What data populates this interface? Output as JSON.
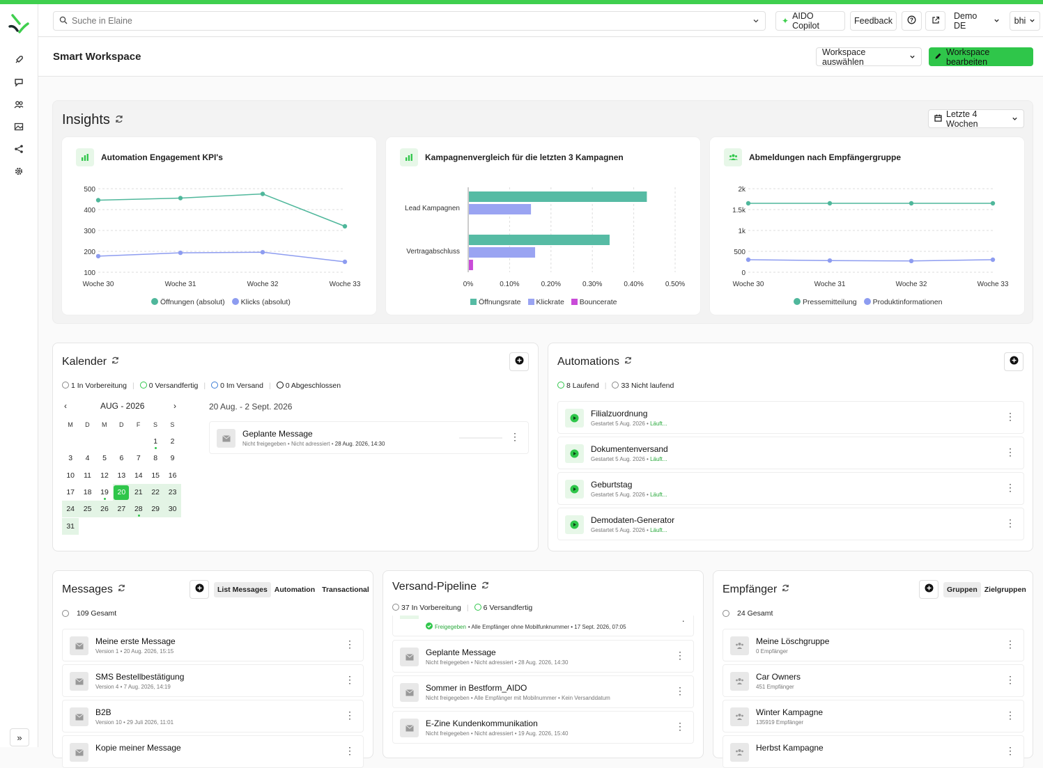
{
  "header": {
    "search_placeholder": "Suche in Elaine",
    "copilot": "AIDO Copilot",
    "feedback": "Feedback",
    "account": "Demo DE",
    "user": "bhi"
  },
  "page": {
    "title": "Smart Workspace",
    "select_workspace": "Workspace auswählen",
    "edit_workspace": "Workspace bearbeiten"
  },
  "insights": {
    "title": "Insights",
    "range": "Letzte 4 Wochen",
    "kpi": {
      "title": "Automation Engagement KPI's",
      "legend": [
        "Öffnungen (absolut)",
        "Klicks (absolut)"
      ]
    },
    "campaign": {
      "title": "Kampagnenvergleich für die letzten 3 Kampagnen",
      "legend": [
        "Öffnungsrate",
        "Klickrate",
        "Bouncerate"
      ]
    },
    "unsub": {
      "title": "Abmeldungen nach Empfängergruppe",
      "legend": [
        "Pressemitteilung",
        "Produktinformationen"
      ]
    }
  },
  "chart_data": [
    {
      "type": "line",
      "categories": [
        "Woche 30",
        "Woche 31",
        "Woche 32",
        "Woche 33"
      ],
      "ylim": [
        100,
        500
      ],
      "yticks": [
        "500",
        "400",
        "300",
        "200",
        "100"
      ],
      "series": [
        {
          "name": "Öffnungen (absolut)",
          "values": [
            445,
            455,
            475,
            320
          ],
          "color": "#4fb79b"
        },
        {
          "name": "Klicks (absolut)",
          "values": [
            177,
            193,
            196,
            150
          ],
          "color": "#8d9cf0"
        }
      ]
    },
    {
      "type": "bar",
      "orientation": "horizontal",
      "categories": [
        "Lead Kampagnen",
        "Vertragabschluss"
      ],
      "xlim": [
        0,
        0.5
      ],
      "xticks": [
        "0%",
        "0.10%",
        "0.20%",
        "0.30%",
        "0.40%",
        "0.50%"
      ],
      "series": [
        {
          "name": "Öffnungsrate",
          "values": [
            0.43,
            0.34
          ],
          "color": "#56bba4"
        },
        {
          "name": "Klickrate",
          "values": [
            0.15,
            0.16
          ],
          "color": "#9aa4f2"
        },
        {
          "name": "Bouncerate",
          "values": [
            0,
            0.01
          ],
          "color": "#c94bd8"
        }
      ]
    },
    {
      "type": "line",
      "categories": [
        "Woche 30",
        "Woche 31",
        "Woche 32",
        "Woche 33"
      ],
      "ylim": [
        0,
        2000
      ],
      "yticks": [
        "2k",
        "1.5k",
        "1k",
        "500",
        "0"
      ],
      "series": [
        {
          "name": "Pressemitteilung",
          "values": [
            1650,
            1650,
            1650,
            1650
          ],
          "color": "#4fb79b"
        },
        {
          "name": "Produktinformationen",
          "values": [
            300,
            280,
            270,
            300
          ],
          "color": "#8d9cf0"
        }
      ]
    }
  ],
  "kalender": {
    "title": "Kalender",
    "status": [
      "1 In Vorbereitung",
      "0 Versandfertig",
      "0 Im Versand",
      "0 Abgeschlossen"
    ],
    "month": "AUG - 2026",
    "weekdays": [
      "M",
      "D",
      "M",
      "D",
      "F",
      "S",
      "S"
    ],
    "range": "20 Aug. - 2 Sept. 2026",
    "msg_title": "Geplante Message",
    "msg_sub_a": "Nicht freigegeben • Nicht adressiert • ",
    "msg_sub_b": "28 Aug. 2026, 14:30"
  },
  "automations": {
    "title": "Automations",
    "status": [
      "8 Laufend",
      "33 Nicht laufend"
    ],
    "items": [
      {
        "t": "Filialzuordnung",
        "s": "Gestartet 5 Aug. 2026 • ",
        "st": "Läuft..."
      },
      {
        "t": "Dokumentenversand",
        "s": "Gestartet 5 Aug. 2026 • ",
        "st": "Läuft..."
      },
      {
        "t": "Geburtstag",
        "s": "Gestartet 5 Aug. 2026 • ",
        "st": "Läuft..."
      },
      {
        "t": "Demodaten-Generator",
        "s": "Gestartet 5 Aug. 2026 • ",
        "st": "Läuft..."
      }
    ]
  },
  "messages": {
    "title": "Messages",
    "tabs": [
      "List Messages",
      "Automation",
      "Transactional"
    ],
    "total": "109 Gesamt",
    "items": [
      {
        "t": "Meine erste Message",
        "s": "Version 1 • 20 Aug. 2026, 15:15"
      },
      {
        "t": "SMS Bestellbestätigung",
        "s": "Version 4 • 7 Aug. 2026, 14:19"
      },
      {
        "t": "B2B",
        "s": "Version 10 • 29 Juli 2026, 11:01"
      },
      {
        "t": "Kopie meiner Message",
        "s": ""
      }
    ]
  },
  "pipeline": {
    "title": "Versand-Pipeline",
    "status": [
      "37 In Vorbereitung",
      "6 Versandfertig"
    ],
    "first_a": "Freigegeben",
    "first_b": " • Alle Empfänger ohne Mobilfunknummer • 17 Sept. 2026, 07:05",
    "items": [
      {
        "t": "Geplante Message",
        "s": "Nicht freigegeben • Nicht adressiert • 28 Aug. 2026, 14:30"
      },
      {
        "t": "Sommer in Bestform_AIDO",
        "s": "Nicht freigegeben • Alle Empfänger mit Mobilnummer • Kein Versanddatum"
      },
      {
        "t": "E-Zine Kundenkommunikation",
        "s": "Nicht freigegeben • Nicht adressiert • 19 Aug. 2026, 15:40"
      }
    ]
  },
  "empfaenger": {
    "title": "Empfänger",
    "tabs": [
      "Gruppen",
      "Zielgruppen"
    ],
    "total": "24 Gesamt",
    "items": [
      {
        "t": "Meine Löschgruppe",
        "s": "0 Empfänger"
      },
      {
        "t": "Car Owners",
        "s": "451 Empfänger"
      },
      {
        "t": "Winter Kampagne",
        "s": "135919 Empfänger"
      },
      {
        "t": "Herbst Kampagne",
        "s": ""
      }
    ]
  }
}
